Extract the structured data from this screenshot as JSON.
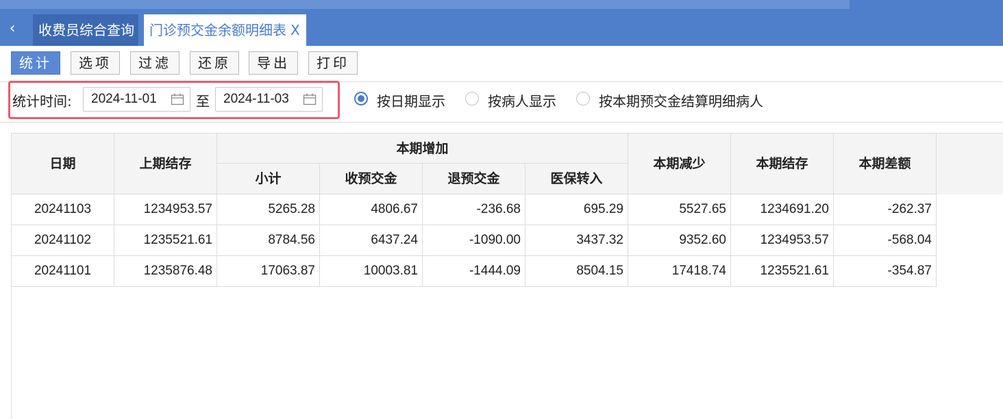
{
  "tabs": [
    {
      "label": "收费员综合查询"
    },
    {
      "label": "门诊预交金余额明细表",
      "close": "X"
    }
  ],
  "toolbar": {
    "stats": "统计",
    "options": "选项",
    "filter": "过滤",
    "restore": "还原",
    "export": "导出",
    "print": "打印"
  },
  "filter": {
    "time_label": "统计时间:",
    "start_date": "2024-11-01",
    "to_label": "至",
    "end_date": "2024-11-03",
    "radio_options": [
      "按日期显示",
      "按病人显示",
      "按本期预交金结算明细病人"
    ],
    "selected_radio": 0
  },
  "table": {
    "headers": {
      "date": "日期",
      "prev_balance": "上期结存",
      "increase_group": "本期增加",
      "subtotal": "小计",
      "deposit_received": "收预交金",
      "deposit_refund": "退预交金",
      "insurance_in": "医保转入",
      "decrease": "本期减少",
      "balance": "本期结存",
      "difference": "本期差额"
    },
    "rows": [
      [
        "20241103",
        "1234953.57",
        "5265.28",
        "4806.67",
        "-236.68",
        "695.29",
        "5527.65",
        "1234691.20",
        "-262.37"
      ],
      [
        "20241102",
        "1235521.61",
        "8784.56",
        "6437.24",
        "-1090.00",
        "3437.32",
        "9352.60",
        "1234953.57",
        "-568.04"
      ],
      [
        "20241101",
        "1235876.48",
        "17063.87",
        "10003.81",
        "-1444.09",
        "8504.15",
        "17418.74",
        "1235521.61",
        "-354.87"
      ]
    ]
  }
}
